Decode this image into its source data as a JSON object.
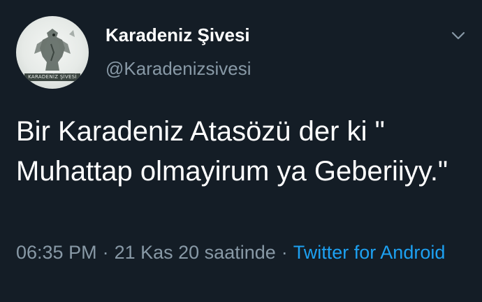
{
  "tweet": {
    "avatar": {
      "icon": "eagle-logo-icon",
      "label": "KARADENİZ ŞİVESİ"
    },
    "display_name": "Karadeniz Şivesi",
    "handle": "@Karadenizsivesi",
    "menu_icon": "chevron-down-icon",
    "text": "Bir Karadeniz Atasözü der ki \" Muhattap olmayirum ya Geberiiyy.\"",
    "time": "06:35 PM",
    "separator": "·",
    "relative_time": "21 Kas 20 saatinde",
    "source": "Twitter for Android"
  },
  "colors": {
    "background": "#141d26",
    "text": "#ffffff",
    "secondary": "#8899a6",
    "link": "#1da1f2"
  }
}
